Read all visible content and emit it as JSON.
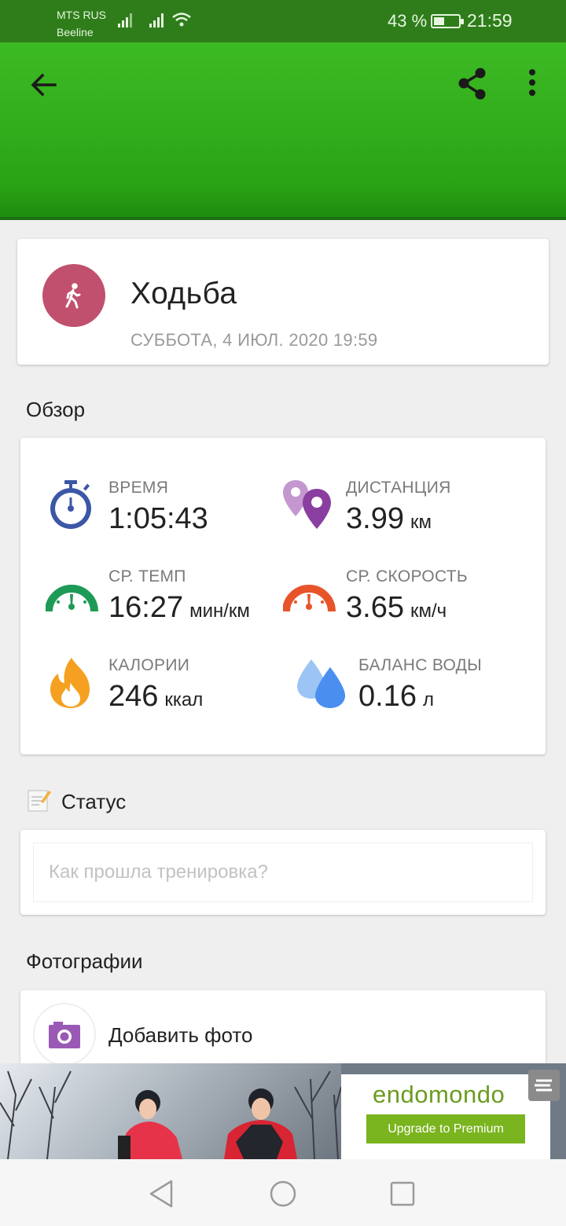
{
  "status_bar": {
    "carrier_1": "MTS RUS",
    "carrier_2": "Beeline",
    "battery_percent": "43 %",
    "battery_level": 0.43,
    "time": "21:59"
  },
  "app_bar": {
    "color": "#2aa315",
    "back_icon": "arrow-back-icon",
    "share_icon": "share-icon",
    "more_icon": "more-vert-icon"
  },
  "workout": {
    "title": "Ходьба",
    "date": "СУББОТА, 4 ИЮЛ. 2020 19:59",
    "icon": "walking-icon",
    "accent": "#c0506e"
  },
  "overview": {
    "heading": "Обзор",
    "stats": [
      {
        "label": "ВРЕМЯ",
        "value": "1:05:43",
        "unit": "",
        "icon": "stopwatch-icon",
        "color": "#3b57a6"
      },
      {
        "label": "ДИСТАНЦИЯ",
        "value": "3.99",
        "unit": "км",
        "icon": "map-pin-icon",
        "color": "#8a3fa0"
      },
      {
        "label": "СР. ТЕМП",
        "value": "16:27",
        "unit": "мин/км",
        "icon": "pace-gauge-icon",
        "color": "#1e9a57"
      },
      {
        "label": "СР. СКОРОСТЬ",
        "value": "3.65",
        "unit": "км/ч",
        "icon": "speed-gauge-icon",
        "color": "#e8542a"
      },
      {
        "label": "КАЛОРИИ",
        "value": "246",
        "unit": "ккал",
        "icon": "flame-icon",
        "color": "#f5a020"
      },
      {
        "label": "БАЛАНС ВОДЫ",
        "value": "0.16",
        "unit": "л",
        "icon": "water-drops-icon",
        "color": "#4a8ef0"
      }
    ]
  },
  "status": {
    "heading": "Статус",
    "icon": "memo-icon",
    "placeholder": "Как прошла тренировка?"
  },
  "photos": {
    "heading": "Фотографии",
    "add_label": "Добавить фото",
    "icon": "camera-icon"
  },
  "ad": {
    "logo": "endomondo",
    "button": "Upgrade to Premium",
    "accent": "#7ab41e"
  },
  "nav": {
    "back_icon": "nav-back-icon",
    "home_icon": "nav-home-icon",
    "recents_icon": "nav-recents-icon"
  }
}
